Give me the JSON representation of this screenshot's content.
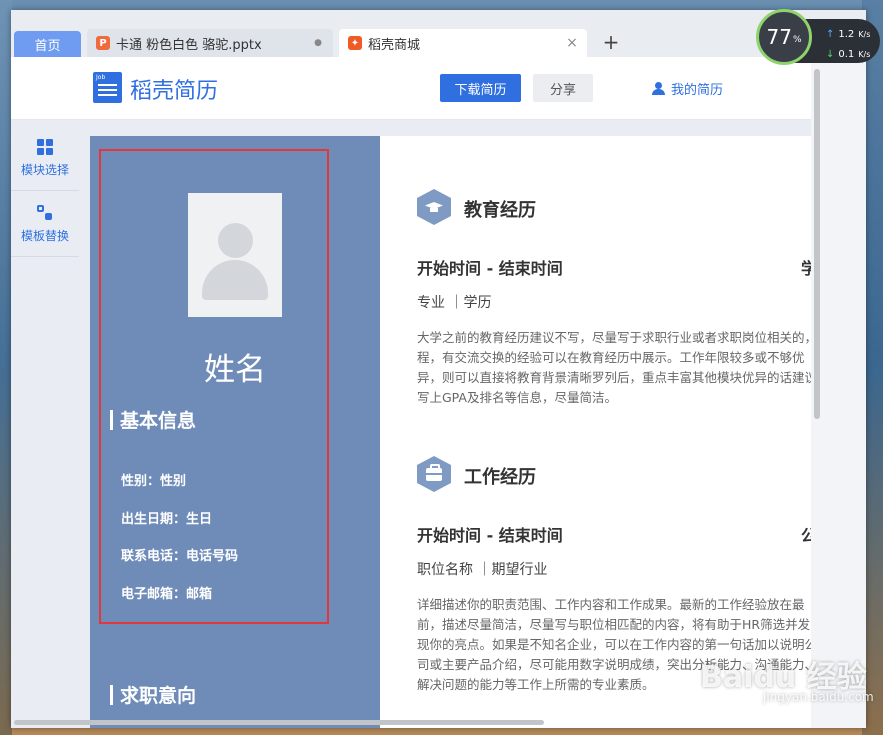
{
  "browser": {
    "tabs": [
      {
        "label": "首页"
      },
      {
        "label": "卡通 粉色白色 骆驼.pptx",
        "icon": "ppt-icon",
        "icon_color": "#f06a3b"
      },
      {
        "label": "稻壳商城",
        "icon": "docer-flame-icon",
        "icon_color": "#f05a24"
      }
    ],
    "new_tab_label": "+",
    "tab_close_glyph": "×",
    "tab_dot_glyph": "●"
  },
  "speed_widget": {
    "percent": "77",
    "percent_sign": "%",
    "upload": "1.2",
    "upload_unit": "K/s",
    "download": "0.1",
    "download_unit": "K/s"
  },
  "header": {
    "logo_badge": "Job",
    "brand": "稻壳简历",
    "download_button": "下载简历",
    "share_button": "分享",
    "my_resume": "我的简历",
    "accent": "#2f6fe0"
  },
  "tools": [
    {
      "label": "模块选择",
      "icon": "grid-icon"
    },
    {
      "label": "模板替换",
      "icon": "swap-icon"
    }
  ],
  "resume": {
    "sidebar_color": "#6f8cb8",
    "name": "姓名",
    "basic_info_title": "基本信息",
    "basic_info": [
      {
        "text": "性别：性别"
      },
      {
        "text": "出生日期：生日"
      },
      {
        "text": "联系电话：电话号码"
      },
      {
        "text": "电子邮箱：邮箱"
      }
    ],
    "job_intent_title": "求职意向",
    "education": {
      "title": "教育经历",
      "time": "开始时间 - 结束时间",
      "right_label": "学",
      "sub": "专业  ｜学历",
      "desc": "大学之前的教育经历建议不写，尽量写于求职行业或者求职岗位相关的，程，有交流交换的经验可以在教育经历中展示。工作年限较多或不够优异，则可以直接将教育背景清晰罗列后，重点丰富其他模块优异的话建议写上GPA及排名等信息，尽量简洁。"
    },
    "work": {
      "title": "工作经历",
      "time": "开始时间 - 结束时间",
      "right_label": "公",
      "sub": "职位名称  ｜期望行业",
      "desc": "详细描述你的职责范围、工作内容和工作成果。最新的工作经验放在最前，描述尽量简洁，尽量写与职位相匹配的内容，将有助于HR筛选并发现你的亮点。如果是不知名企业，可以在工作内容的第一句话加以说明公司或主要产品介绍，尽可能用数字说明成绩，突出分析能力、沟通能力、解决问题的能力等工作上所需的专业素质。"
    }
  },
  "watermark": {
    "main": "Baidu 经验",
    "sub": "jingyan.baidu.com"
  }
}
